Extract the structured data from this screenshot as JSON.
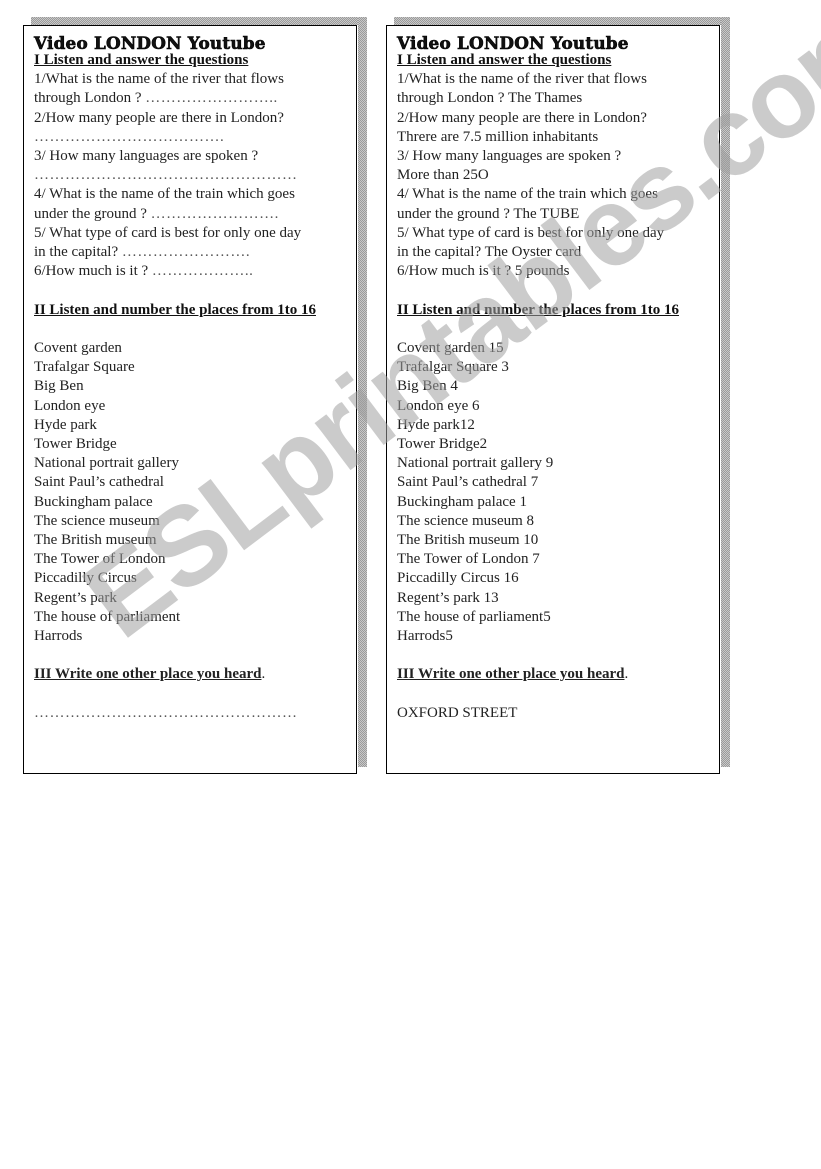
{
  "worksheet_title": "Video LONDON Youtube",
  "section1_heading": "I Listen and answer the questions",
  "section2_heading": "II Listen and number the places from 1to 16",
  "section3_heading": "III Write one other place you heard",
  "section3_heading_suffix": ".",
  "questions": [
    {
      "line1": "1/What is the name of the river that flows",
      "line2": "through London ? "
    },
    {
      "line1": "2/How many people are there in London?"
    },
    {
      "line1": "3/ How many languages are spoken ?"
    },
    {
      "line1": "4/ What is the name of the train which goes",
      "line2": "under  the ground  ? "
    },
    {
      "line1": "5/ What type of card is best for only one day",
      "line2": "in the capital? "
    },
    {
      "line1": "6/How much is it ? "
    }
  ],
  "student_sheet": {
    "blanks": {
      "q1": "……………………..",
      "q2": "……………………………….",
      "q3": "……………………………………………",
      "q4": "…………………….",
      "q5": "…………………….",
      "q6": "………………..",
      "other_place": "……………………………………………"
    },
    "places": [
      "Covent garden",
      "Trafalgar Square",
      "Big Ben",
      "London eye",
      "Hyde park",
      "Tower Bridge",
      "National portrait gallery",
      "Saint Paul’s cathedral",
      "Buckingham palace",
      "The science museum",
      "The British museum",
      "The Tower of London",
      "Piccadilly Circus",
      "Regent’s park",
      "The house of parliament",
      "Harrods"
    ]
  },
  "answer_key": {
    "answers": {
      "q1": "The Thames",
      "q2": "Threre are 7.5 million inhabitants",
      "q3": "More than 25O",
      "q4": "The TUBE",
      "q5": "The Oyster card",
      "q6": "5 pounds",
      "other_place": "OXFORD STREET"
    },
    "places": [
      "Covent garden 15",
      "Trafalgar Square 3",
      "Big Ben 4",
      "London eye 6",
      "Hyde park12",
      "Tower Bridge2",
      "National portrait gallery 9",
      "Saint Paul’s cathedral 7",
      "Buckingham palace 1",
      "The science museum 8",
      "The British museum 10",
      "The Tower of London 7",
      "Piccadilly Circus 16",
      "Regent’s park 13",
      "The house of parliament5",
      "Harrods5"
    ]
  },
  "watermark": "ESLprintables.com"
}
